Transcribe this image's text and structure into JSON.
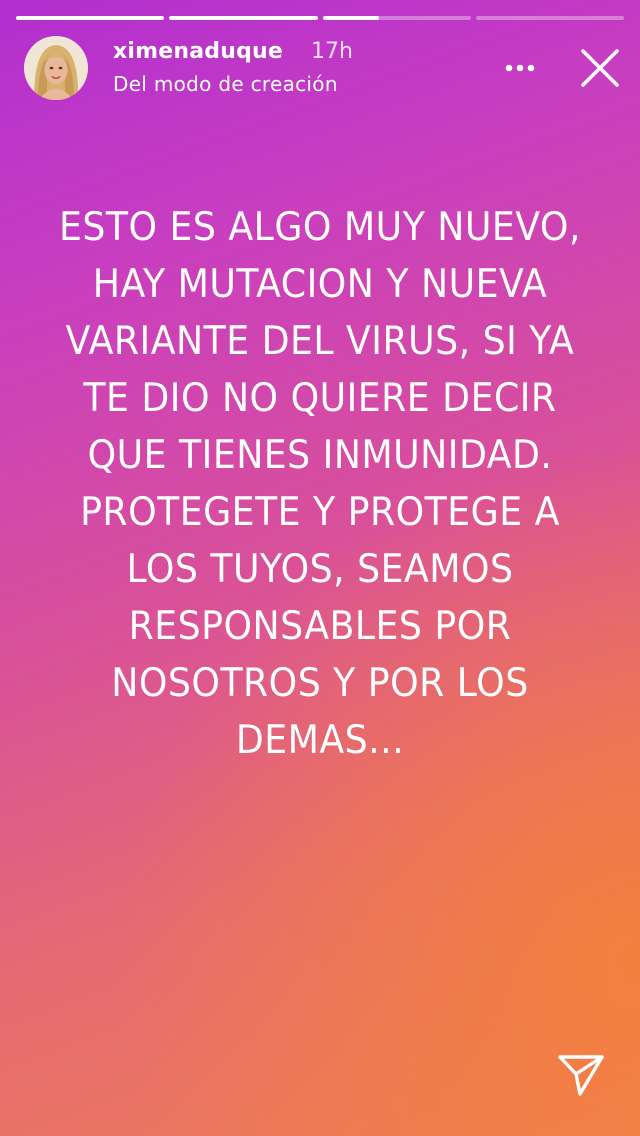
{
  "story": {
    "progress_segments": [
      {
        "fill": 1.0
      },
      {
        "fill": 1.0
      },
      {
        "fill": 0.38
      },
      {
        "fill": 0.0
      }
    ],
    "username": "ximenaduque",
    "time_ago": "17h",
    "subtitle": "Del modo de creación",
    "message": "ESTO ES ALGO MUY NUEVO, HAY MUTACION Y NUEVA VARIANTE DEL VIRUS, SI YA TE DIO NO QUIERE DECIR QUE TIENES INMUNIDAD. PROTEGETE Y PROTEGE A LOS TUYOS, SEAMOS RESPONSABLES POR NOSOTROS Y POR LOS DEMAS...",
    "icons": {
      "more": "more-options-icon",
      "close": "close-icon",
      "send": "send-icon"
    }
  }
}
